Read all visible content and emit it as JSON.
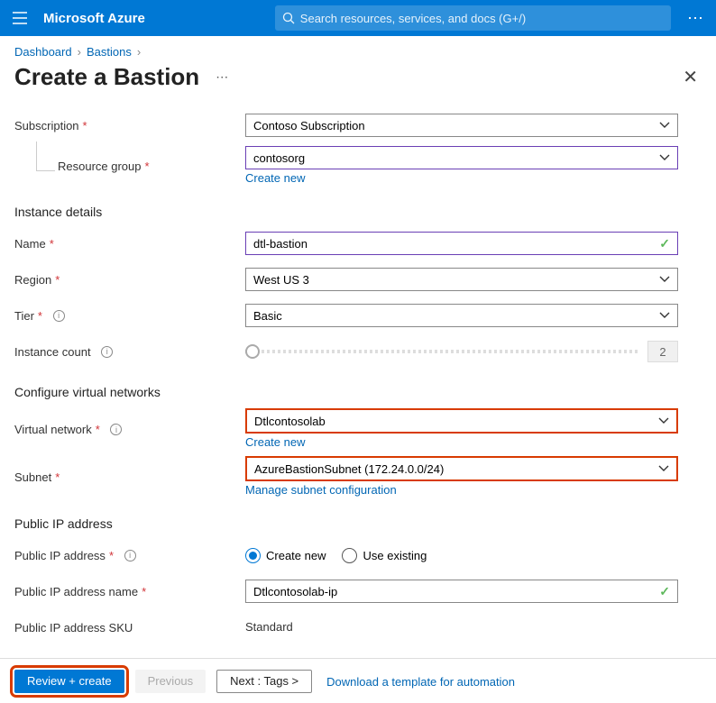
{
  "topbar": {
    "brand": "Microsoft Azure",
    "search_placeholder": "Search resources, services, and docs (G+/)"
  },
  "breadcrumb": {
    "items": [
      "Dashboard",
      "Bastions"
    ]
  },
  "title": "Create a Bastion",
  "fields": {
    "subscription": {
      "label": "Subscription",
      "value": "Contoso Subscription"
    },
    "resource_group": {
      "label": "Resource group",
      "value": "contosorg",
      "link": "Create new"
    },
    "section_instance": "Instance details",
    "name": {
      "label": "Name",
      "value": "dtl-bastion"
    },
    "region": {
      "label": "Region",
      "value": "West US 3"
    },
    "tier": {
      "label": "Tier",
      "value": "Basic"
    },
    "instance_count": {
      "label": "Instance count",
      "value": "2"
    },
    "section_vnet": "Configure virtual networks",
    "vnet": {
      "label": "Virtual network",
      "value": "Dtlcontosolab",
      "link": "Create new"
    },
    "subnet": {
      "label": "Subnet",
      "value": "AzureBastionSubnet (172.24.0.0/24)",
      "link": "Manage subnet configuration"
    },
    "section_ip": "Public IP address",
    "public_ip": {
      "label": "Public IP address",
      "opt1": "Create new",
      "opt2": "Use existing"
    },
    "public_ip_name": {
      "label": "Public IP address name",
      "value": "Dtlcontosolab-ip"
    },
    "public_ip_sku": {
      "label": "Public IP address SKU",
      "value": "Standard"
    }
  },
  "footer": {
    "review": "Review + create",
    "previous": "Previous",
    "next": "Next : Tags >",
    "download": "Download a template for automation"
  }
}
